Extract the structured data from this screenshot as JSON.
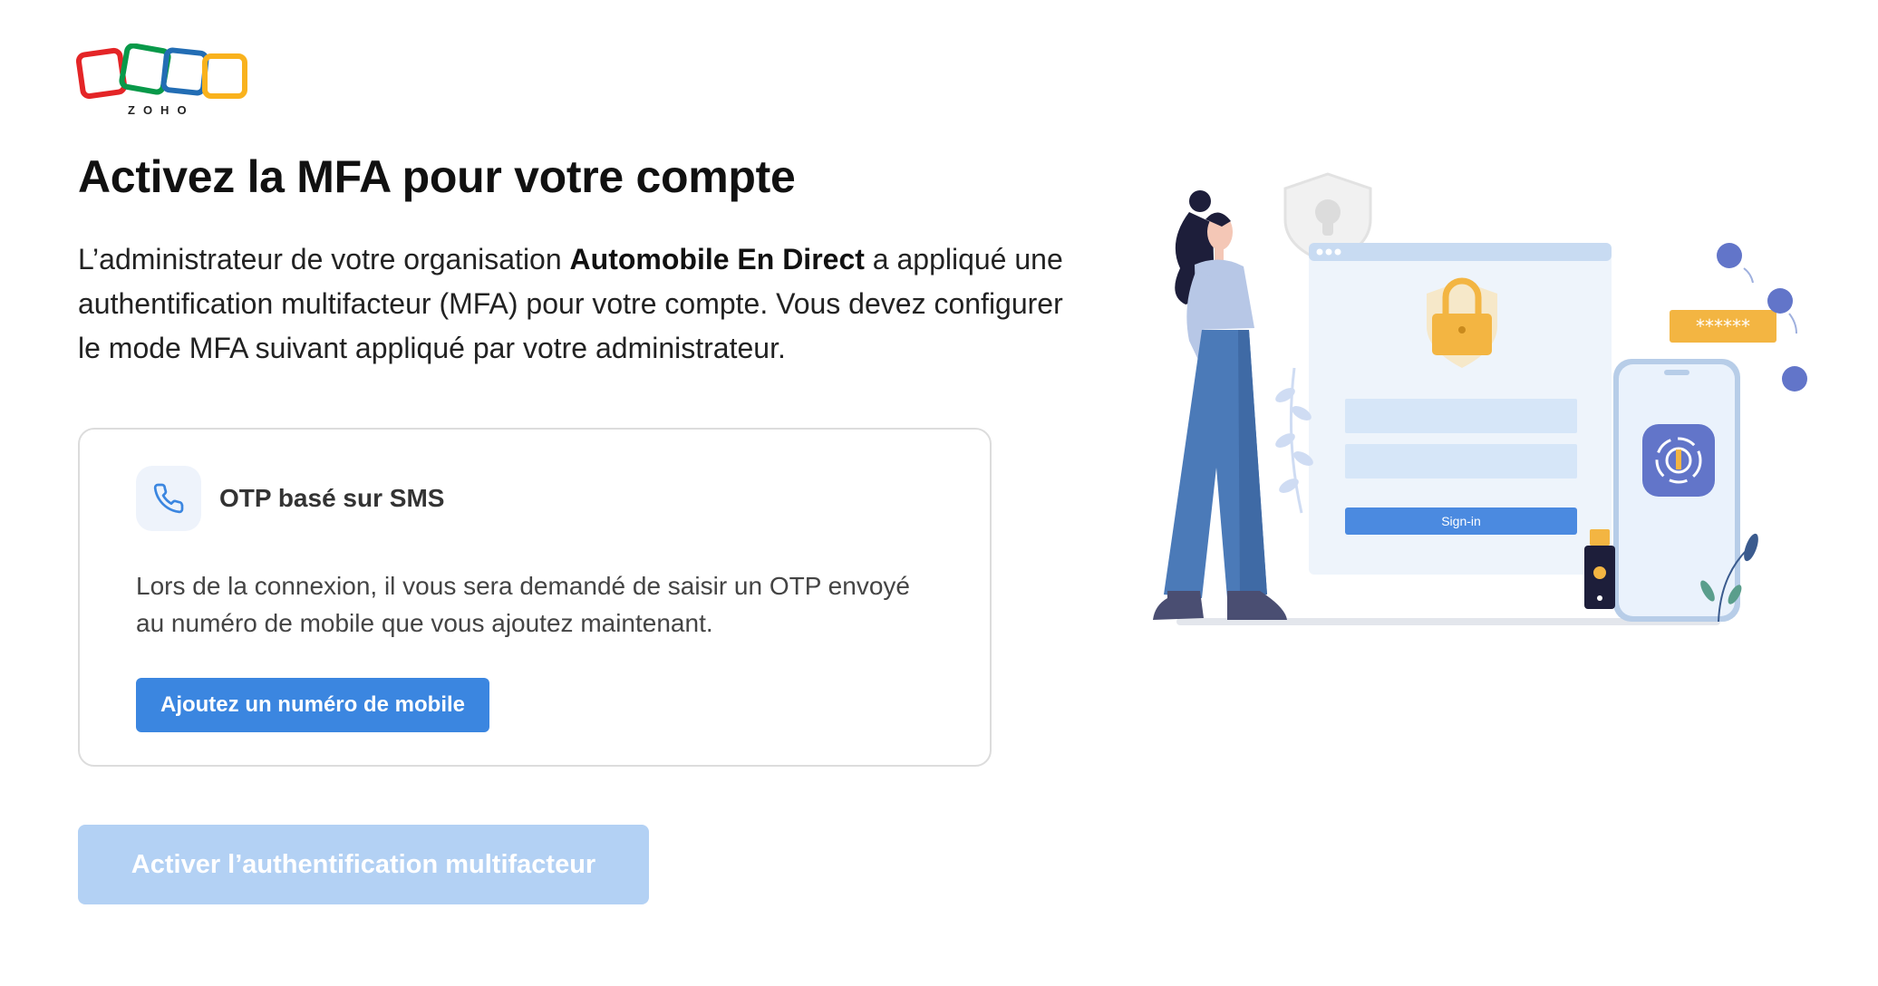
{
  "brand": {
    "logo_text": "ZOHO",
    "colors": {
      "red": "#e42527",
      "green": "#089949",
      "blue": "#226db4",
      "yellow": "#f9b21d"
    }
  },
  "page": {
    "title": "Activez la MFA pour votre compte",
    "description_prefix": "L’administrateur de votre organisation ",
    "organization_name": "Automobile En Direct",
    "description_suffix": " a appliqué une authentification multifacteur (MFA) pour votre compte. Vous devez configurer le mode MFA suivant appliqué par votre administrateur."
  },
  "mfa_method": {
    "icon": "phone-icon",
    "title": "OTP basé sur SMS",
    "description": "Lors de la connexion, il vous sera demandé de saisir un OTP envoyé au numéro de mobile que vous ajoutez maintenant.",
    "action_label": "Ajoutez un numéro de mobile"
  },
  "enable_button": {
    "label": "Activer l’authentification multifacteur",
    "disabled": true
  },
  "illustration": {
    "signin_label": "Sign-in",
    "password_mask": "******"
  },
  "colors": {
    "primary": "#3b86e0",
    "primary_disabled": "#b3d1f4",
    "card_border": "#dcdcdc",
    "icon_bg": "#eef3fb"
  }
}
